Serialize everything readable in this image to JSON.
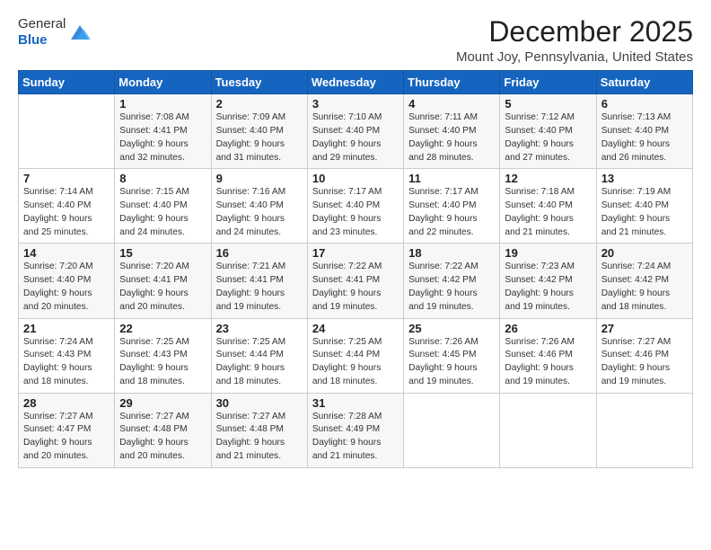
{
  "logo": {
    "general": "General",
    "blue": "Blue"
  },
  "title": "December 2025",
  "subtitle": "Mount Joy, Pennsylvania, United States",
  "days_header": [
    "Sunday",
    "Monday",
    "Tuesday",
    "Wednesday",
    "Thursday",
    "Friday",
    "Saturday"
  ],
  "weeks": [
    [
      {
        "day": "",
        "info": ""
      },
      {
        "day": "1",
        "info": "Sunrise: 7:08 AM\nSunset: 4:41 PM\nDaylight: 9 hours\nand 32 minutes."
      },
      {
        "day": "2",
        "info": "Sunrise: 7:09 AM\nSunset: 4:40 PM\nDaylight: 9 hours\nand 31 minutes."
      },
      {
        "day": "3",
        "info": "Sunrise: 7:10 AM\nSunset: 4:40 PM\nDaylight: 9 hours\nand 29 minutes."
      },
      {
        "day": "4",
        "info": "Sunrise: 7:11 AM\nSunset: 4:40 PM\nDaylight: 9 hours\nand 28 minutes."
      },
      {
        "day": "5",
        "info": "Sunrise: 7:12 AM\nSunset: 4:40 PM\nDaylight: 9 hours\nand 27 minutes."
      },
      {
        "day": "6",
        "info": "Sunrise: 7:13 AM\nSunset: 4:40 PM\nDaylight: 9 hours\nand 26 minutes."
      }
    ],
    [
      {
        "day": "7",
        "info": "Sunrise: 7:14 AM\nSunset: 4:40 PM\nDaylight: 9 hours\nand 25 minutes."
      },
      {
        "day": "8",
        "info": "Sunrise: 7:15 AM\nSunset: 4:40 PM\nDaylight: 9 hours\nand 24 minutes."
      },
      {
        "day": "9",
        "info": "Sunrise: 7:16 AM\nSunset: 4:40 PM\nDaylight: 9 hours\nand 24 minutes."
      },
      {
        "day": "10",
        "info": "Sunrise: 7:17 AM\nSunset: 4:40 PM\nDaylight: 9 hours\nand 23 minutes."
      },
      {
        "day": "11",
        "info": "Sunrise: 7:17 AM\nSunset: 4:40 PM\nDaylight: 9 hours\nand 22 minutes."
      },
      {
        "day": "12",
        "info": "Sunrise: 7:18 AM\nSunset: 4:40 PM\nDaylight: 9 hours\nand 21 minutes."
      },
      {
        "day": "13",
        "info": "Sunrise: 7:19 AM\nSunset: 4:40 PM\nDaylight: 9 hours\nand 21 minutes."
      }
    ],
    [
      {
        "day": "14",
        "info": "Sunrise: 7:20 AM\nSunset: 4:40 PM\nDaylight: 9 hours\nand 20 minutes."
      },
      {
        "day": "15",
        "info": "Sunrise: 7:20 AM\nSunset: 4:41 PM\nDaylight: 9 hours\nand 20 minutes."
      },
      {
        "day": "16",
        "info": "Sunrise: 7:21 AM\nSunset: 4:41 PM\nDaylight: 9 hours\nand 19 minutes."
      },
      {
        "day": "17",
        "info": "Sunrise: 7:22 AM\nSunset: 4:41 PM\nDaylight: 9 hours\nand 19 minutes."
      },
      {
        "day": "18",
        "info": "Sunrise: 7:22 AM\nSunset: 4:42 PM\nDaylight: 9 hours\nand 19 minutes."
      },
      {
        "day": "19",
        "info": "Sunrise: 7:23 AM\nSunset: 4:42 PM\nDaylight: 9 hours\nand 19 minutes."
      },
      {
        "day": "20",
        "info": "Sunrise: 7:24 AM\nSunset: 4:42 PM\nDaylight: 9 hours\nand 18 minutes."
      }
    ],
    [
      {
        "day": "21",
        "info": "Sunrise: 7:24 AM\nSunset: 4:43 PM\nDaylight: 9 hours\nand 18 minutes."
      },
      {
        "day": "22",
        "info": "Sunrise: 7:25 AM\nSunset: 4:43 PM\nDaylight: 9 hours\nand 18 minutes."
      },
      {
        "day": "23",
        "info": "Sunrise: 7:25 AM\nSunset: 4:44 PM\nDaylight: 9 hours\nand 18 minutes."
      },
      {
        "day": "24",
        "info": "Sunrise: 7:25 AM\nSunset: 4:44 PM\nDaylight: 9 hours\nand 18 minutes."
      },
      {
        "day": "25",
        "info": "Sunrise: 7:26 AM\nSunset: 4:45 PM\nDaylight: 9 hours\nand 19 minutes."
      },
      {
        "day": "26",
        "info": "Sunrise: 7:26 AM\nSunset: 4:46 PM\nDaylight: 9 hours\nand 19 minutes."
      },
      {
        "day": "27",
        "info": "Sunrise: 7:27 AM\nSunset: 4:46 PM\nDaylight: 9 hours\nand 19 minutes."
      }
    ],
    [
      {
        "day": "28",
        "info": "Sunrise: 7:27 AM\nSunset: 4:47 PM\nDaylight: 9 hours\nand 20 minutes."
      },
      {
        "day": "29",
        "info": "Sunrise: 7:27 AM\nSunset: 4:48 PM\nDaylight: 9 hours\nand 20 minutes."
      },
      {
        "day": "30",
        "info": "Sunrise: 7:27 AM\nSunset: 4:48 PM\nDaylight: 9 hours\nand 21 minutes."
      },
      {
        "day": "31",
        "info": "Sunrise: 7:28 AM\nSunset: 4:49 PM\nDaylight: 9 hours\nand 21 minutes."
      },
      {
        "day": "",
        "info": ""
      },
      {
        "day": "",
        "info": ""
      },
      {
        "day": "",
        "info": ""
      }
    ]
  ]
}
